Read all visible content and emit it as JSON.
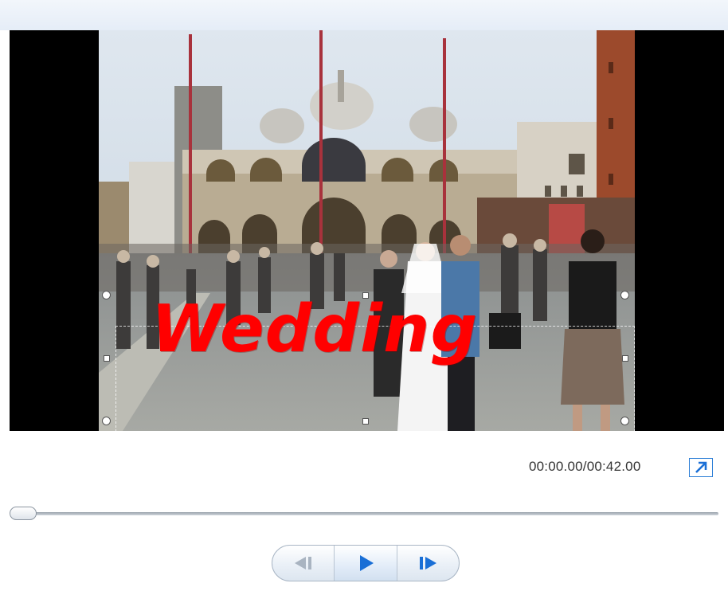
{
  "player": {
    "caption_text": "Wedding",
    "time_readout": "00:00.00/00:42.00",
    "seek_position": 0
  },
  "buttons": {
    "previous_frame": "previous-frame",
    "play": "play",
    "next_frame": "next-frame",
    "fullscreen": "fullscreen-expand"
  },
  "colors": {
    "caption": "#ff0000",
    "accent": "#1a6fd6",
    "letterbox": "#000000"
  }
}
